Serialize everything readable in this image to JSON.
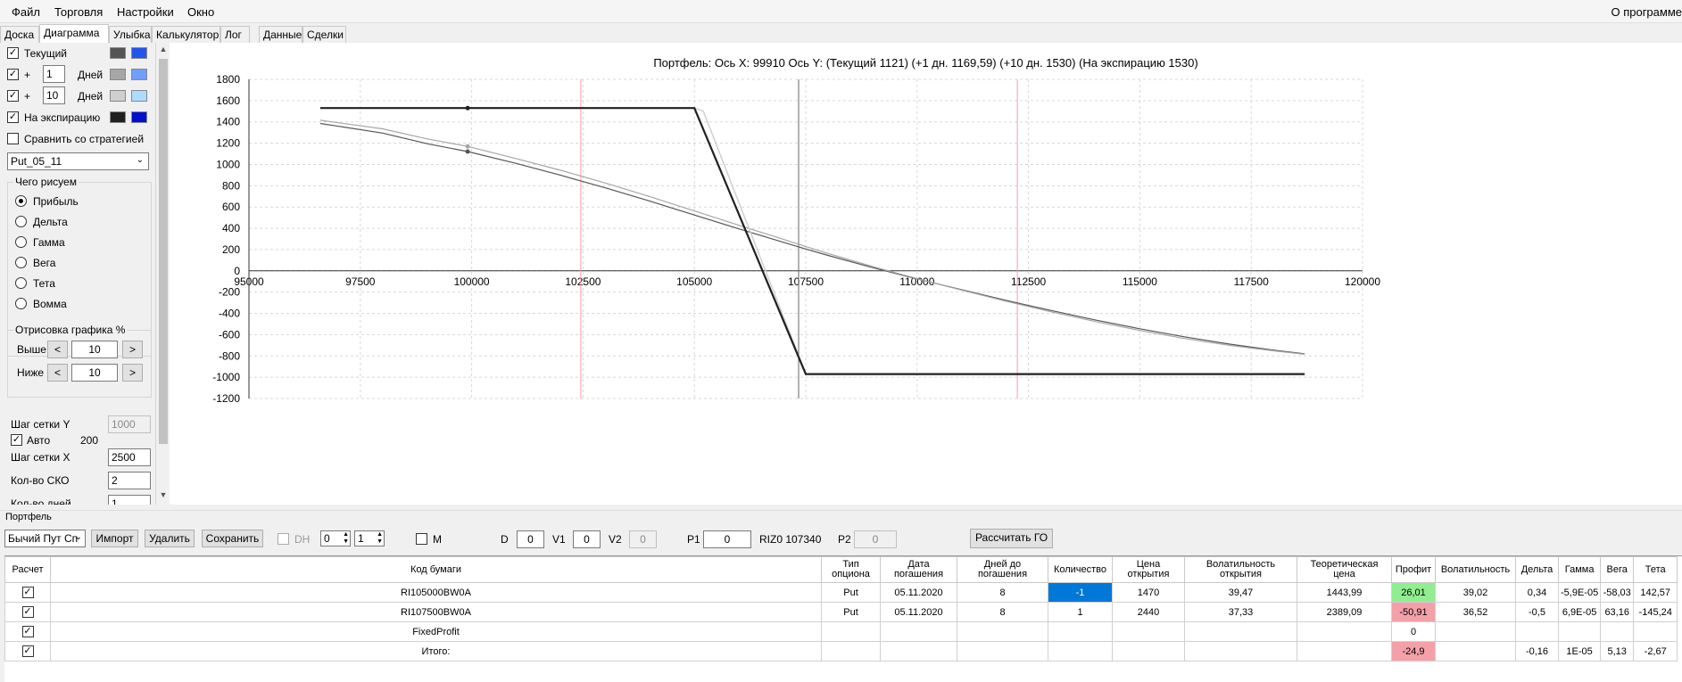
{
  "menu": {
    "items": [
      "Файл",
      "Торговля",
      "Настройки",
      "Окно"
    ],
    "right": "О программе"
  },
  "tabs": [
    "Доска",
    "Диаграмма",
    "Улыбка",
    "Калькулятор",
    "Лог",
    "Данные",
    "Сделки"
  ],
  "active_tab": "Диаграмма",
  "sidebar": {
    "rows": [
      {
        "checked": true,
        "label": "Текущий",
        "colors": [
          "#555555",
          "#2255ee"
        ]
      },
      {
        "checked": true,
        "prefix": "+",
        "value": "1",
        "unit": "Дней",
        "colors": [
          "#a6a6a6",
          "#6f9fff"
        ]
      },
      {
        "checked": true,
        "prefix": "+",
        "value": "10",
        "unit": "Дней",
        "colors": [
          "#cfcfcf",
          "#aaddff"
        ]
      },
      {
        "checked": true,
        "label": "На экспирацию",
        "colors": [
          "#202020",
          "#0010cc"
        ]
      }
    ],
    "compare_label": "Сравнить со стратегией",
    "strategy_select": "Put_05_11",
    "draw_group_title": "Чего рисуем",
    "draw_options": [
      "Прибыль",
      "Дельта",
      "Гамма",
      "Вега",
      "Тета",
      "Вомма"
    ],
    "draw_selected": "Прибыль",
    "render_group_title": "Отрисовка графика %",
    "above_label": "Выше",
    "above_value": "10",
    "below_label": "Ниже",
    "below_value": "10",
    "left_btn": "<",
    "right_btn": ">",
    "grid_y_label": "Шаг сетки Y",
    "grid_y_value": "1000",
    "auto_label": "Авто",
    "auto_value": "200",
    "grid_x_label": "Шаг сетки X",
    "grid_x_value": "2500",
    "sko_label": "Кол-во СКО",
    "sko_value": "2",
    "days_label": "Кол-во дней",
    "days_value": "1"
  },
  "chart_data": {
    "type": "line",
    "title": "Портфель: Ось X: 99910 Ось Y:  (Текущий 1121)  (+1 дн. 1169,59)  (+10 дн. 1530)  (На экспирацию 1530)",
    "xlim": [
      95000,
      120000
    ],
    "ylim": [
      -1200,
      1800
    ],
    "x_ticks": [
      95000,
      97500,
      100000,
      102500,
      105000,
      107500,
      110000,
      112500,
      115000,
      117500,
      120000
    ],
    "y_ticks": [
      1800,
      1600,
      1400,
      1200,
      1000,
      800,
      600,
      400,
      200,
      0,
      -200,
      -400,
      -600,
      -800,
      -1000,
      -1200
    ],
    "grid": true,
    "vertical_markers": {
      "current_price": 107340,
      "sigma_lines": [
        102450,
        112250
      ]
    },
    "marker_x": 99910,
    "series": [
      {
        "color": "#555555",
        "points": [
          [
            96600,
            1385
          ],
          [
            98000,
            1295
          ],
          [
            99000,
            1195
          ],
          [
            99910,
            1121
          ],
          [
            101000,
            1010
          ],
          [
            102000,
            898
          ],
          [
            103000,
            780
          ],
          [
            104000,
            655
          ],
          [
            105000,
            525
          ],
          [
            106000,
            395
          ],
          [
            107000,
            268
          ],
          [
            107500,
            205
          ],
          [
            108000,
            145
          ],
          [
            109000,
            30
          ],
          [
            110000,
            -75
          ],
          [
            111000,
            -178
          ],
          [
            112000,
            -278
          ],
          [
            113000,
            -372
          ],
          [
            114000,
            -462
          ],
          [
            115000,
            -545
          ],
          [
            116000,
            -620
          ],
          [
            117000,
            -688
          ],
          [
            118000,
            -745
          ],
          [
            118700,
            -780
          ]
        ]
      },
      {
        "color": "#a6a6a6",
        "points": [
          [
            96600,
            1415
          ],
          [
            98000,
            1335
          ],
          [
            99000,
            1240
          ],
          [
            99910,
            1169.59
          ],
          [
            101000,
            1055
          ],
          [
            102000,
            945
          ],
          [
            103000,
            825
          ],
          [
            104000,
            697
          ],
          [
            105000,
            563
          ],
          [
            106000,
            428
          ],
          [
            107000,
            297
          ],
          [
            107500,
            228
          ],
          [
            108000,
            163
          ],
          [
            109000,
            40
          ],
          [
            110000,
            -73
          ],
          [
            111000,
            -181
          ],
          [
            112000,
            -286
          ],
          [
            113000,
            -385
          ],
          [
            114000,
            -477
          ],
          [
            115000,
            -561
          ],
          [
            116000,
            -636
          ],
          [
            117000,
            -700
          ],
          [
            118000,
            -752
          ],
          [
            118700,
            -784
          ]
        ]
      },
      {
        "color": "#cfcfcf",
        "points": [
          [
            96600,
            1530
          ],
          [
            105000,
            1530
          ],
          [
            105200,
            1500
          ],
          [
            107500,
            -970
          ],
          [
            118700,
            -970
          ]
        ]
      },
      {
        "color": "#202020",
        "points": [
          [
            96600,
            1530
          ],
          [
            105000,
            1530
          ],
          [
            107500,
            -970
          ],
          [
            118700,
            -970
          ]
        ]
      }
    ]
  },
  "portfolio": {
    "label": "Портфель",
    "strategy_select": "Бычий Пут Сп",
    "import_btn": "Импорт",
    "delete_btn": "Удалить",
    "save_btn": "Сохранить",
    "dh_label": "DH",
    "spin1": "0",
    "spin2": "1",
    "m_label": "M",
    "d_label": "D",
    "d_value": "0",
    "v1_label": "V1",
    "v1_value": "0",
    "v2_label": "V2",
    "v2_value": "0",
    "p1_label": "P1",
    "p1_value": "0",
    "riz_label": "RIZ0 107340",
    "p2_label": "P2",
    "p2_value": "0",
    "calc_go_btn": "Рассчитать ГО"
  },
  "table": {
    "headers": [
      "Расчет",
      "Код бумаги",
      "Тип опциона",
      "Дата погашения",
      "Дней до погашения",
      "Количество",
      "Цена открытия",
      "Волатильность открытия",
      "Теоретическая цена",
      "Профит",
      "Волатильность",
      "Дельта",
      "Гамма",
      "Вега",
      "Тета"
    ],
    "rows": [
      [
        "✓",
        "RI105000BW0A",
        "Put",
        "05.11.2020",
        "8",
        "-1",
        "1470",
        "39,47",
        "1443,99",
        "26,01",
        "39,02",
        "0,34",
        "-5,9E-05",
        "-58,03",
        "142,57"
      ],
      [
        "✓",
        "RI107500BW0A",
        "Put",
        "05.11.2020",
        "8",
        "1",
        "2440",
        "37,33",
        "2389,09",
        "-50,91",
        "36,52",
        "-0,5",
        "6,9E-05",
        "63,16",
        "-145,24"
      ],
      [
        "✓",
        "FixedProfit",
        "",
        "",
        "",
        "",
        "",
        "",
        "",
        "0",
        "",
        "",
        "",
        "",
        ""
      ],
      [
        "✓",
        "Итого:",
        "",
        "",
        "",
        "",
        "",
        "",
        "",
        "-24,9",
        "",
        "-0,16",
        "1E-05",
        "5,13",
        "-2,67"
      ]
    ]
  }
}
